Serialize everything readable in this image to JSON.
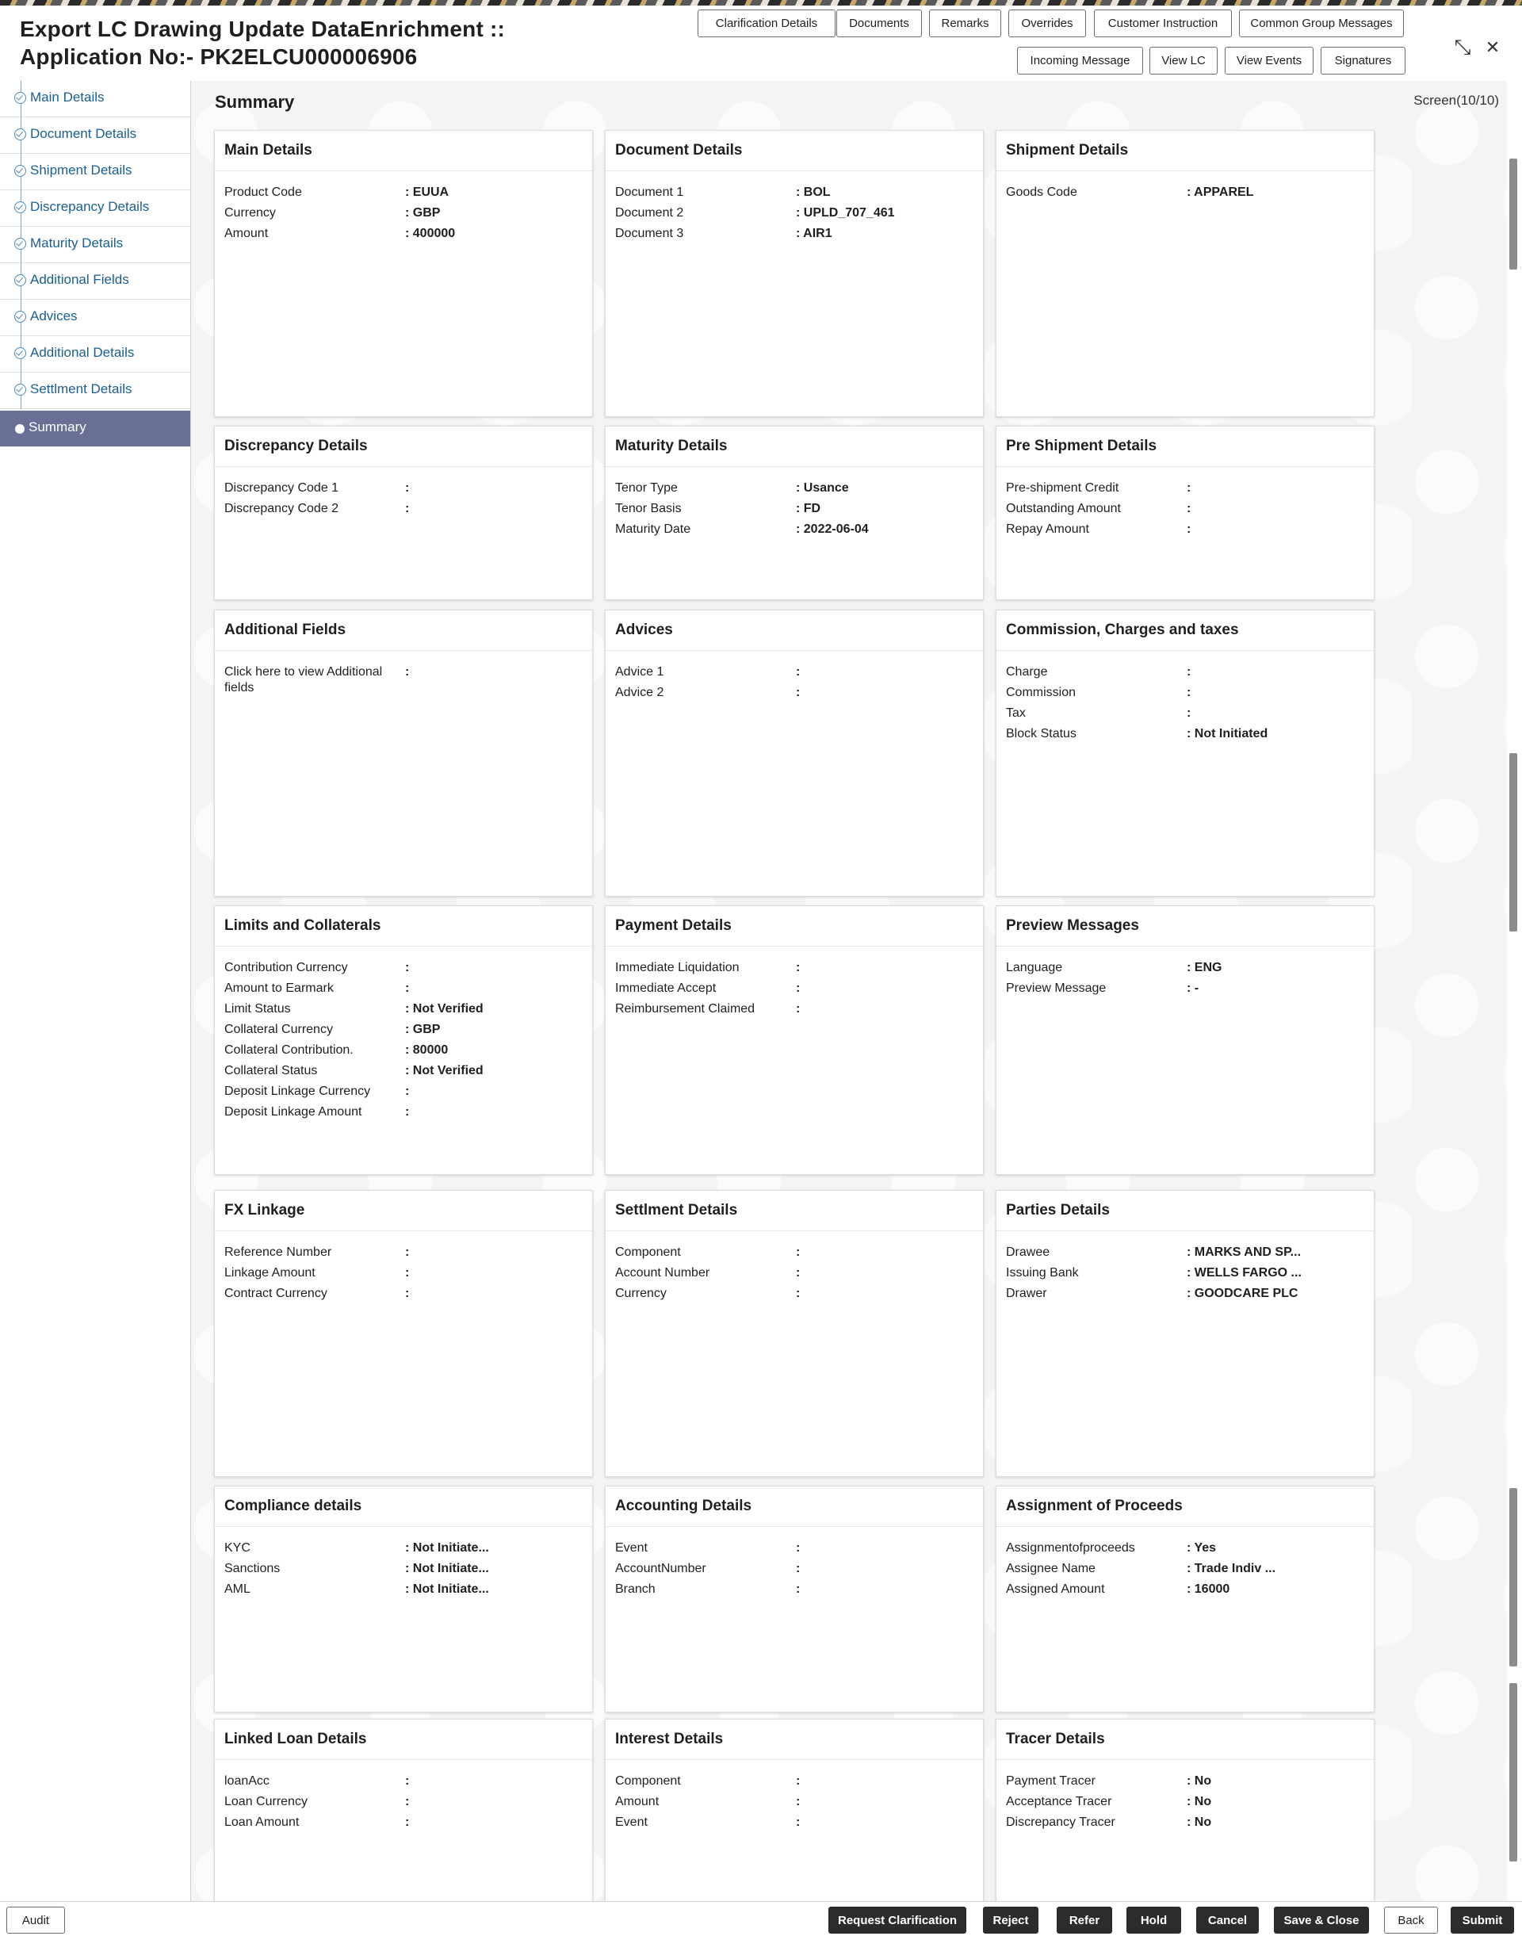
{
  "header": {
    "title": "Export LC Drawing Update DataEnrichment :: Application No:- PK2ELCU000006906",
    "buttons": [
      "Clarification Details",
      "Documents",
      "Remarks",
      "Overrides",
      "Customer Instruction",
      "Common Group Messages",
      "Incoming Message",
      "View LC",
      "View Events",
      "Signatures"
    ],
    "collapse_icon": "⤡",
    "close_icon": "✕"
  },
  "sidebar": {
    "items": [
      {
        "label": "Main Details"
      },
      {
        "label": "Document Details"
      },
      {
        "label": "Shipment Details"
      },
      {
        "label": "Discrepancy Details"
      },
      {
        "label": "Maturity Details"
      },
      {
        "label": "Additional Fields"
      },
      {
        "label": "Advices"
      },
      {
        "label": "Additional Details"
      },
      {
        "label": "Settlment Details"
      },
      {
        "label": "Summary"
      }
    ],
    "active": "Summary"
  },
  "main": {
    "title": "Summary",
    "screen_count": "Screen(10/10)",
    "cards": [
      {
        "title": "Main Details",
        "rows": [
          [
            "Product Code",
            ": EUUA"
          ],
          [
            "Currency",
            ": GBP"
          ],
          [
            "Amount",
            ": 400000"
          ]
        ]
      },
      {
        "title": "Document Details",
        "rows": [
          [
            "Document 1",
            ": BOL"
          ],
          [
            "Document 2",
            ": UPLD_707_461"
          ],
          [
            "Document 3",
            ": AIR1"
          ]
        ]
      },
      {
        "title": "Shipment Details",
        "rows": [
          [
            "Goods Code",
            ": APPAREL"
          ]
        ]
      },
      {
        "title": "Discrepancy Details",
        "rows": [
          [
            "Discrepancy Code 1",
            ":"
          ],
          [
            "Discrepancy Code 2",
            ":"
          ]
        ]
      },
      {
        "title": "Maturity Details",
        "rows": [
          [
            "Tenor Type",
            ": Usance"
          ],
          [
            "Tenor Basis",
            ": FD"
          ],
          [
            "Maturity Date",
            ": 2022-06-04"
          ]
        ]
      },
      {
        "title": "Pre Shipment Details",
        "rows": [
          [
            "Pre-shipment Credit",
            ":"
          ],
          [
            "Outstanding Amount",
            ":"
          ],
          [
            "Repay Amount",
            ":"
          ]
        ]
      },
      {
        "title": "Additional Fields",
        "rows": [
          [
            "Click here to view Additional fields",
            ":"
          ]
        ]
      },
      {
        "title": "Advices",
        "rows": [
          [
            "Advice 1",
            ":"
          ],
          [
            "Advice 2",
            ":"
          ]
        ]
      },
      {
        "title": "Commission, Charges and taxes",
        "rows": [
          [
            "Charge",
            ":"
          ],
          [
            "Commission",
            ":"
          ],
          [
            "Tax",
            ":"
          ],
          [
            "Block Status",
            ": Not Initiated"
          ]
        ]
      },
      {
        "title": "Limits and Collaterals",
        "rows": [
          [
            "Contribution Currency",
            ":"
          ],
          [
            "Amount to Earmark",
            ":"
          ],
          [
            "Limit Status",
            ": Not Verified"
          ],
          [
            "Collateral Currency",
            ": GBP"
          ],
          [
            "Collateral Contribution.",
            ": 80000"
          ],
          [
            "Collateral Status",
            ": Not Verified"
          ],
          [
            "Deposit Linkage Currency",
            ":"
          ],
          [
            "Deposit Linkage Amount",
            ":"
          ]
        ]
      },
      {
        "title": "Payment Details",
        "rows": [
          [
            "Immediate Liquidation",
            ":"
          ],
          [
            "Immediate Accept",
            ":"
          ],
          [
            "Reimbursement Claimed",
            ":"
          ]
        ]
      },
      {
        "title": "Preview Messages",
        "rows": [
          [
            "Language",
            ": ENG"
          ],
          [
            "Preview Message",
            ": -"
          ]
        ]
      },
      {
        "title": "FX Linkage",
        "rows": [
          [
            "Reference Number",
            ":"
          ],
          [
            "Linkage Amount",
            ":"
          ],
          [
            "Contract Currency",
            ":"
          ]
        ]
      },
      {
        "title": "Settlment Details",
        "rows": [
          [
            "Component",
            ":"
          ],
          [
            "Account Number",
            ":"
          ],
          [
            "Currency",
            ":"
          ]
        ]
      },
      {
        "title": "Parties Details",
        "rows": [
          [
            "Drawee",
            ": MARKS AND SP..."
          ],
          [
            "Issuing Bank",
            ": WELLS FARGO ..."
          ],
          [
            "Drawer",
            ": GOODCARE PLC"
          ]
        ]
      },
      {
        "title": "Compliance details",
        "rows": [
          [
            "KYC",
            ": Not Initiate..."
          ],
          [
            "Sanctions",
            ": Not Initiate..."
          ],
          [
            "AML",
            ": Not Initiate..."
          ]
        ]
      },
      {
        "title": "Accounting Details",
        "rows": [
          [
            "Event",
            ":"
          ],
          [
            "AccountNumber",
            ":"
          ],
          [
            "Branch",
            ":"
          ]
        ]
      },
      {
        "title": "Assignment of Proceeds",
        "rows": [
          [
            "Assignmentofproceeds",
            ": Yes"
          ],
          [
            "Assignee Name",
            ": Trade Indiv ..."
          ],
          [
            "Assigned Amount",
            ": 16000"
          ]
        ]
      },
      {
        "title": "Linked Loan Details",
        "rows": [
          [
            "loanAcc",
            ":"
          ],
          [
            "Loan Currency",
            ":"
          ],
          [
            "Loan Amount",
            ":"
          ]
        ]
      },
      {
        "title": "Interest Details",
        "rows": [
          [
            "Component",
            ":"
          ],
          [
            "Amount",
            ":"
          ],
          [
            "Event",
            ":"
          ]
        ]
      },
      {
        "title": "Tracer Details",
        "rows": [
          [
            "Payment Tracer",
            ": No"
          ],
          [
            "Acceptance Tracer",
            ": No"
          ],
          [
            "Discrepancy Tracer",
            ": No"
          ]
        ]
      }
    ]
  },
  "footer": {
    "audit": "Audit",
    "buttons": [
      "Request Clarification",
      "Reject",
      "Refer",
      "Hold",
      "Cancel",
      "Save & Close",
      "Back",
      "Submit"
    ]
  }
}
